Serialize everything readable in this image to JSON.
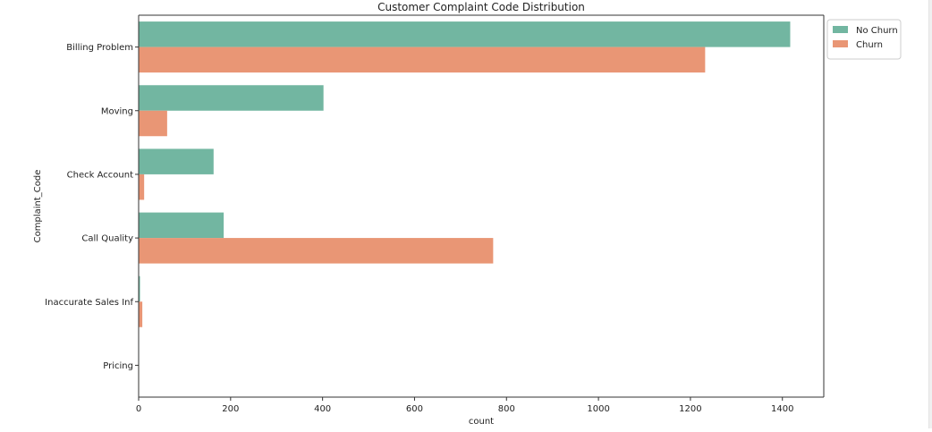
{
  "chart_data": {
    "type": "bar",
    "orientation": "horizontal",
    "title": "Customer Complaint Code Distribution",
    "xlabel": "count",
    "ylabel": "Complaint_Code",
    "categories": [
      "Billing Problem",
      "Moving",
      "Check Account",
      "Call Quality",
      "Inaccurate Sales Inf",
      "Pricing"
    ],
    "series": [
      {
        "name": "No Churn",
        "color": "#72b6a1",
        "values": [
          1417,
          402,
          163,
          185,
          3,
          1
        ]
      },
      {
        "name": "Churn",
        "color": "#e99675",
        "values": [
          1232,
          62,
          12,
          771,
          8,
          1
        ]
      }
    ],
    "xlim": [
      0,
      1490
    ],
    "xticks": [
      0,
      200,
      400,
      600,
      800,
      1000,
      1200,
      1400
    ],
    "grid": false,
    "legend_position": "upper right, outside plot"
  }
}
